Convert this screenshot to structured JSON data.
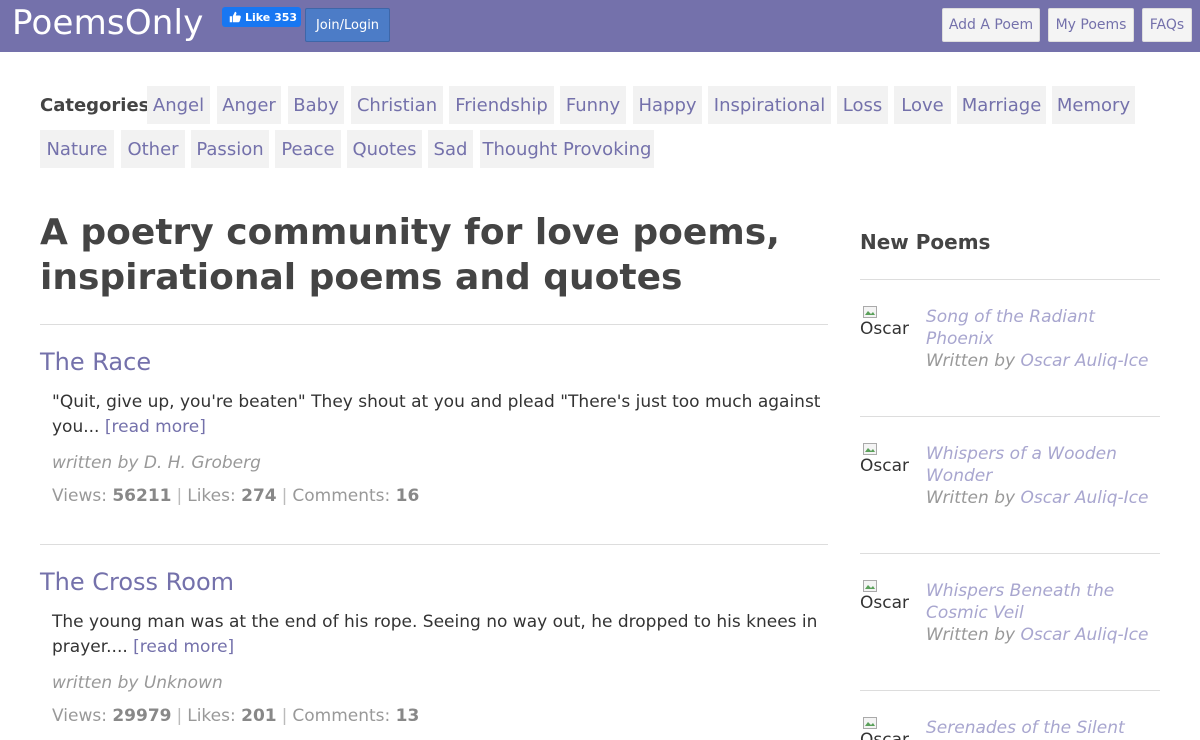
{
  "header": {
    "logo": "PoemsOnly",
    "fb_like": "Like 353",
    "join_login": "Join/Login",
    "nav": [
      "Add A Poem",
      "My Poems",
      "FAQs"
    ]
  },
  "categories": {
    "label": "Categories:",
    "items": [
      "Angel",
      "Anger",
      "Baby",
      "Christian",
      "Friendship",
      "Funny",
      "Happy",
      "Inspirational",
      "Loss",
      "Love",
      "Marriage",
      "Memory",
      "Nature",
      "Other",
      "Passion",
      "Peace",
      "Quotes",
      "Sad",
      "Thought Provoking"
    ]
  },
  "main": {
    "title_line1": "A poetry community for love poems,",
    "title_line2": "inspirational poems and quotes",
    "read_more": "[read more]",
    "poems": [
      {
        "title": "The Race",
        "excerpt": "\"Quit, give up, you're beaten\" They shout at you and plead \"There's just too much against you...",
        "author": "written by D. H. Groberg",
        "views_label": "Views:",
        "views": "56211",
        "likes_label": "Likes:",
        "likes": "274",
        "comments_label": "Comments:",
        "comments": "16"
      },
      {
        "title": "The Cross Room",
        "excerpt": "The young man was at the end of his rope. Seeing no way out, he dropped to his knees in prayer....",
        "author": "written by Unknown",
        "views_label": "Views:",
        "views": "29979",
        "likes_label": "Likes:",
        "likes": "201",
        "comments_label": "Comments:",
        "comments": "13"
      }
    ]
  },
  "sidebar": {
    "title": "New Poems",
    "written_by": "Written by",
    "items": [
      {
        "img_alt": "Oscar",
        "title": "Song of the Radiant Phoenix",
        "author": "Oscar Auliq-Ice"
      },
      {
        "img_alt": "Oscar",
        "title": "Whispers of a Wooden Wonder",
        "author": "Oscar Auliq-Ice"
      },
      {
        "img_alt": "Oscar",
        "title": "Whispers Beneath the Cosmic Veil",
        "author": "Oscar Auliq-Ice"
      },
      {
        "img_alt": "Oscar",
        "title": "Serenades of the Silent",
        "author": ""
      }
    ]
  },
  "colors": {
    "brand": "#7471ab",
    "join_button": "#4c7cc7",
    "facebook": "#1877f2"
  }
}
